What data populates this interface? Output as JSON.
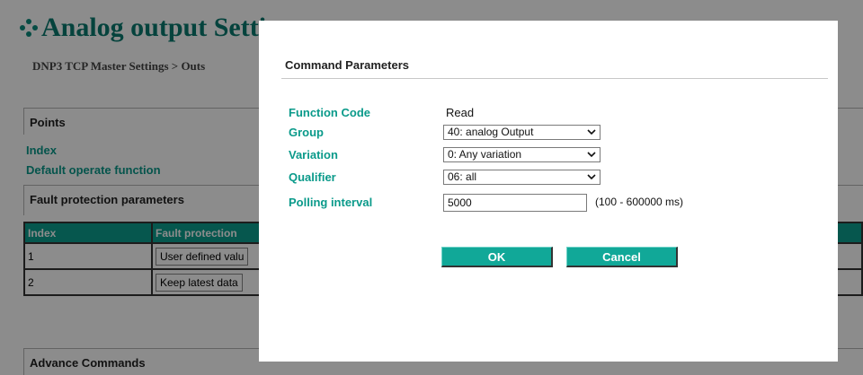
{
  "page": {
    "title": "Analog output Setti",
    "breadcrumb": "DNP3 TCP Master Settings > Outs",
    "sections": {
      "points": "Points",
      "fault_params": "Fault protection parameters",
      "advance": "Advance Commands"
    },
    "links": {
      "index": "Index",
      "default_operate": "Default operate function"
    },
    "fault_table": {
      "columns": [
        "Index",
        "Fault protection"
      ],
      "rows": [
        {
          "index": "1",
          "value": "User defined valu"
        },
        {
          "index": "2",
          "value": "Keep latest data"
        }
      ]
    }
  },
  "dialog": {
    "title": "Command Parameters",
    "function_code": {
      "label": "Function Code",
      "value": "Read"
    },
    "group": {
      "label": "Group",
      "value": "40: analog Output"
    },
    "variation": {
      "label": "Variation",
      "value": "0: Any variation"
    },
    "qualifier": {
      "label": "Qualifier",
      "value": "06: all"
    },
    "polling": {
      "label": "Polling interval",
      "value": "5000",
      "range": "(100 - 600000 ms)"
    },
    "ok_label": "OK",
    "cancel_label": "Cancel"
  },
  "colors": {
    "accent": "#0a9a8a",
    "button": "#11a898",
    "table_header": "#0c9e8f"
  }
}
